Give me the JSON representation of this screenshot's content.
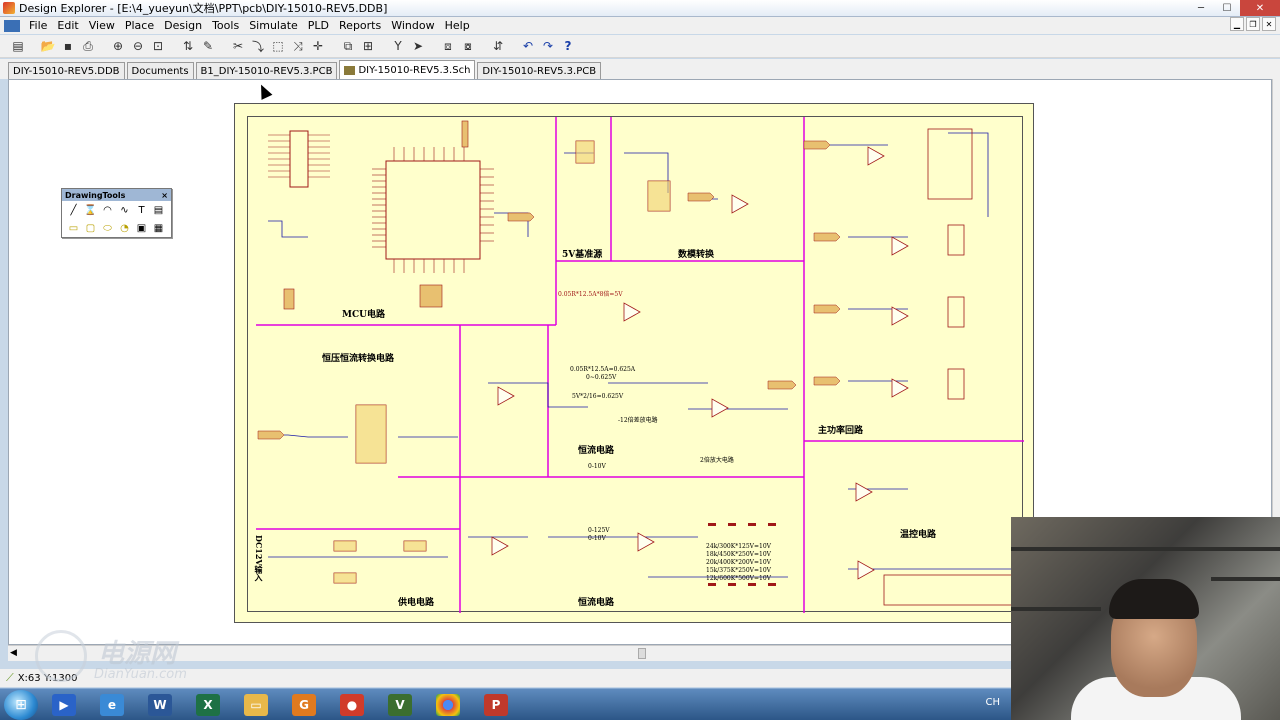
{
  "window": {
    "title": "Design Explorer - [E:\\4_yueyun\\文档\\PPT\\pcb\\DIY-15010-REV5.DDB]",
    "buttons": {
      "minimize": "─",
      "maximize": "☐",
      "close": "✕"
    }
  },
  "menu": {
    "items": [
      "File",
      "Edit",
      "View",
      "Place",
      "Design",
      "Tools",
      "Simulate",
      "PLD",
      "Reports",
      "Window",
      "Help"
    ]
  },
  "tabs": [
    {
      "label": "DIY-15010-REV5.DDB",
      "active": false
    },
    {
      "label": "Documents",
      "active": false
    },
    {
      "label": "B1_DIY-15010-REV5.3.PCB",
      "active": false
    },
    {
      "label": "DIY-15010-REV5.3.Sch",
      "active": true
    },
    {
      "label": "DIY-15010-REV5.3.PCB",
      "active": false
    }
  ],
  "drawing_tools": {
    "title": "DrawingTools",
    "close": "×"
  },
  "schematic": {
    "blocks": {
      "mcu": "MCU电路",
      "ref5v": "5V基准源",
      "dac": "数模转换",
      "cvcc": "恒压恒流转换电路",
      "cc1": "恒流电路",
      "power_loop": "主功率回路",
      "temp": "温控电路",
      "supply": "供电电路",
      "cc2": "恒流电路",
      "dc12v": "DC12V输入"
    },
    "notes": {
      "n1": "0.05R*12.5A*8倍=5V",
      "n2": "0.05R*12.5A=0.625A",
      "n3": "0~0.625V",
      "n4": "5V*2/16=0.625V",
      "n5": "-12倍差放电路",
      "n6": "2倍放大电路",
      "n7": "0-10V",
      "n8": "0-125V",
      "n9": "0-10V",
      "r1": "24k/300K*125V=10V",
      "r2": "18k/450K*250V=10V",
      "r3": "20k/400K*200V=10V",
      "r4": "15k/375K*250V=10V",
      "r5": "12k/600K*500V=10V"
    }
  },
  "status": {
    "coords": "X:63 Y:1300"
  },
  "watermark": {
    "brand": "电源网",
    "url": "DianYuan.com"
  },
  "tray": {
    "lang": "CH"
  },
  "colors": {
    "sheet_bg": "#ffffcc",
    "block_divider": "#e000e0",
    "wire": "#1a1aa8",
    "component": "#a01818"
  }
}
